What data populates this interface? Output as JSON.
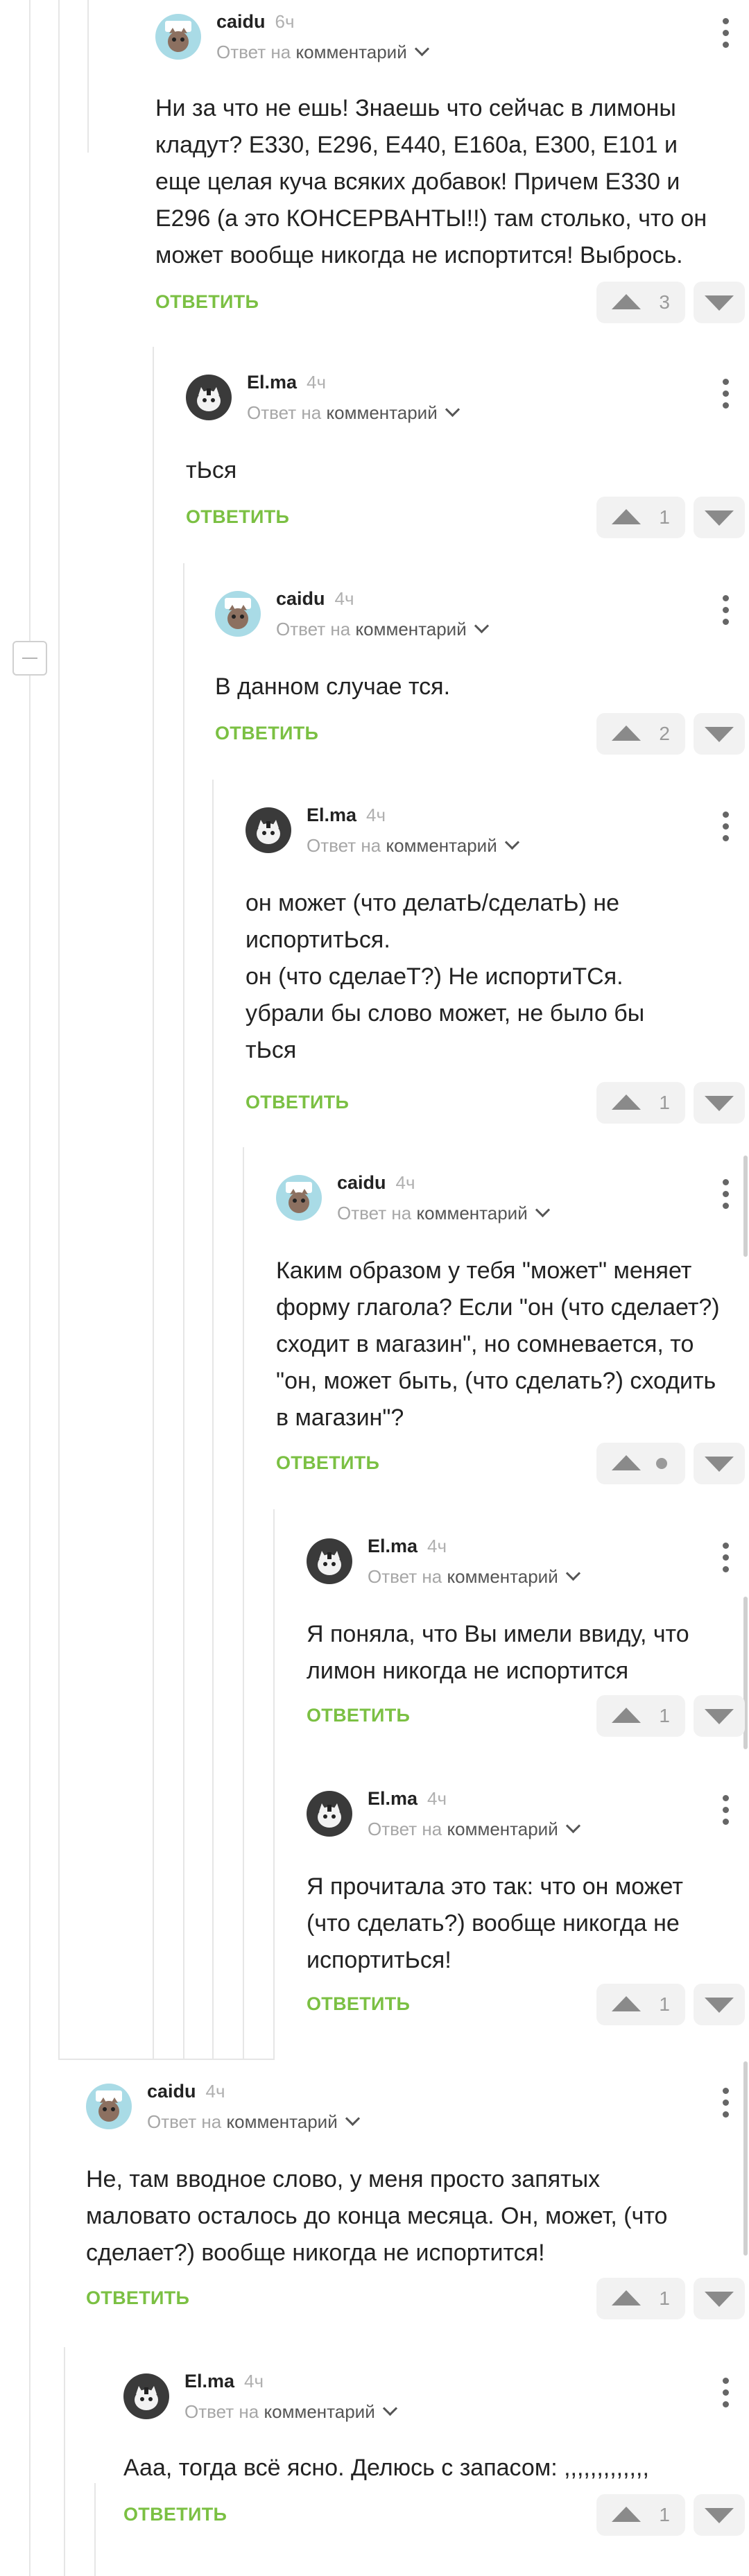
{
  "labels": {
    "reply_to": "Ответ на",
    "comment_word": "комментарий",
    "reply_button": "ОТВЕТИТЬ"
  },
  "comments": [
    {
      "author": "caidu",
      "time": "6ч",
      "paragraphs": [
        "Ни за что не ешь! Знаешь что сейчас в лимоны кладут? Е330, Е296, Е440, Е160а, Е300, Е101 и еще целая куча всяких добавок! Причем Е330 и Е296 (а это КОНСЕРВАНТЫ!!) там столько, что он может вообще никогда не испортится! Выбрось."
      ],
      "votes": "3"
    },
    {
      "author": "El.ma",
      "time": "4ч",
      "paragraphs": [
        "тЬся"
      ],
      "votes": "1"
    },
    {
      "author": "caidu",
      "time": "4ч",
      "paragraphs": [
        "В данном случае тся."
      ],
      "votes": "2"
    },
    {
      "author": "El.ma",
      "time": "4ч",
      "paragraphs": [
        "он может (что делатЬ/сделатЬ) не испортитЬся.",
        "он (что сделаеТ?) Не испортиТСя. убрали бы слово может, не было бы тЬся"
      ],
      "votes": "1"
    },
    {
      "author": "caidu",
      "time": "4ч",
      "paragraphs": [
        "Каким образом у тебя \"может\" меняет форму глагола? Если \"он (что сделает?) сходит в магазин\", но сомневается, то \"он, может быть, (что сделать?) сходить в магазин\"?"
      ],
      "votes": ""
    },
    {
      "author": "El.ma",
      "time": "4ч",
      "paragraphs": [
        "Я поняла, что Вы имели ввиду, что лимон никогда не испортится"
      ],
      "votes": "1"
    },
    {
      "author": "El.ma",
      "time": "4ч",
      "paragraphs": [
        "Я прочитала это так: что он может (что сделать?) вообще никогда не испортитЬся!"
      ],
      "votes": "1"
    },
    {
      "author": "caidu",
      "time": "4ч",
      "paragraphs": [
        "Не, там вводное слово, у меня просто запятых маловато осталось до конца месяца. Он, может, (что сделает?) вообще никогда не испортится!"
      ],
      "votes": "1"
    },
    {
      "author": "El.ma",
      "time": "4ч",
      "paragraphs": [
        "Ааа, тогда всё ясно. Делюсь с запасом: ,,,,,,,,,,,,,"
      ],
      "votes": "1"
    }
  ]
}
